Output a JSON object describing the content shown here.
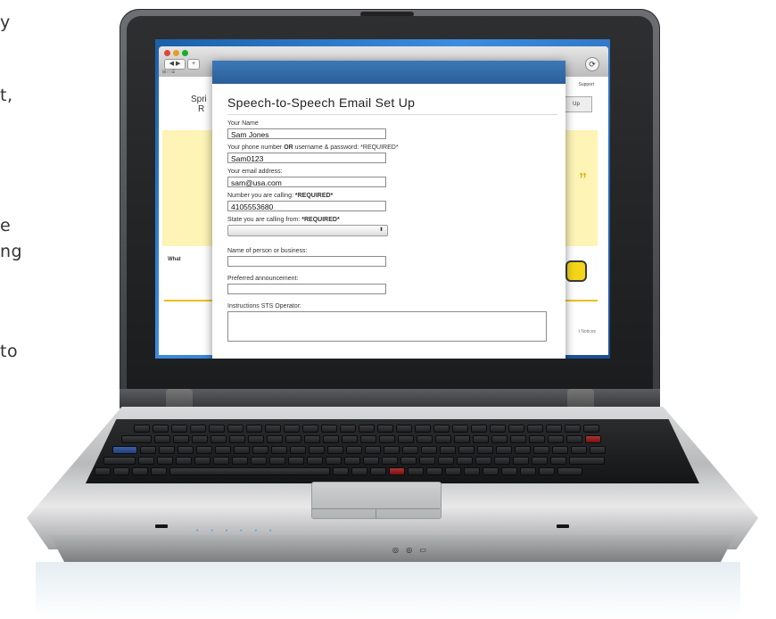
{
  "side_text": [
    "y",
    "t,",
    "e",
    "ng",
    "to"
  ],
  "browser": {
    "back_label": "◀ ▶",
    "add_label": "+",
    "reload_label": "⟳",
    "bookmarks_text": "⊞ □ ☰",
    "support_text": "Support",
    "background_heading_1": "Spri",
    "background_heading_2": "R",
    "whats_text": "What",
    "notices_text": "t Notices",
    "right_button_text": "Up",
    "quote_text": "”"
  },
  "form": {
    "title": "Speech-to-Speech Email Set Up",
    "fields": [
      {
        "label_pre": "Your Name",
        "label_bold": "",
        "label_post": "",
        "value": "Sam Jones"
      },
      {
        "label_pre": "Your phone number ",
        "label_bold": "OR",
        "label_post": " username & password: *REQUIRED*",
        "value": "Sam0123"
      },
      {
        "label_pre": "Your email address:",
        "label_bold": "",
        "label_post": "",
        "value": "sam@usa.com"
      },
      {
        "label_pre": "Number you are calling: ",
        "label_bold": "*REQUIRED*",
        "label_post": "",
        "value": "4105553680"
      }
    ],
    "state_label_pre": "State you are calling from: ",
    "state_label_bold": "*REQUIRED*",
    "state_value": "",
    "name_business_label": "Name of person or business:",
    "name_business_value": "",
    "announcement_label": "Preferred announcement:",
    "announcement_value": "",
    "instructions_label": "Instructions STS Operator:"
  },
  "colors": {
    "modal_header": "#2f6aa8",
    "accent_yellow": "#e8c21b"
  }
}
